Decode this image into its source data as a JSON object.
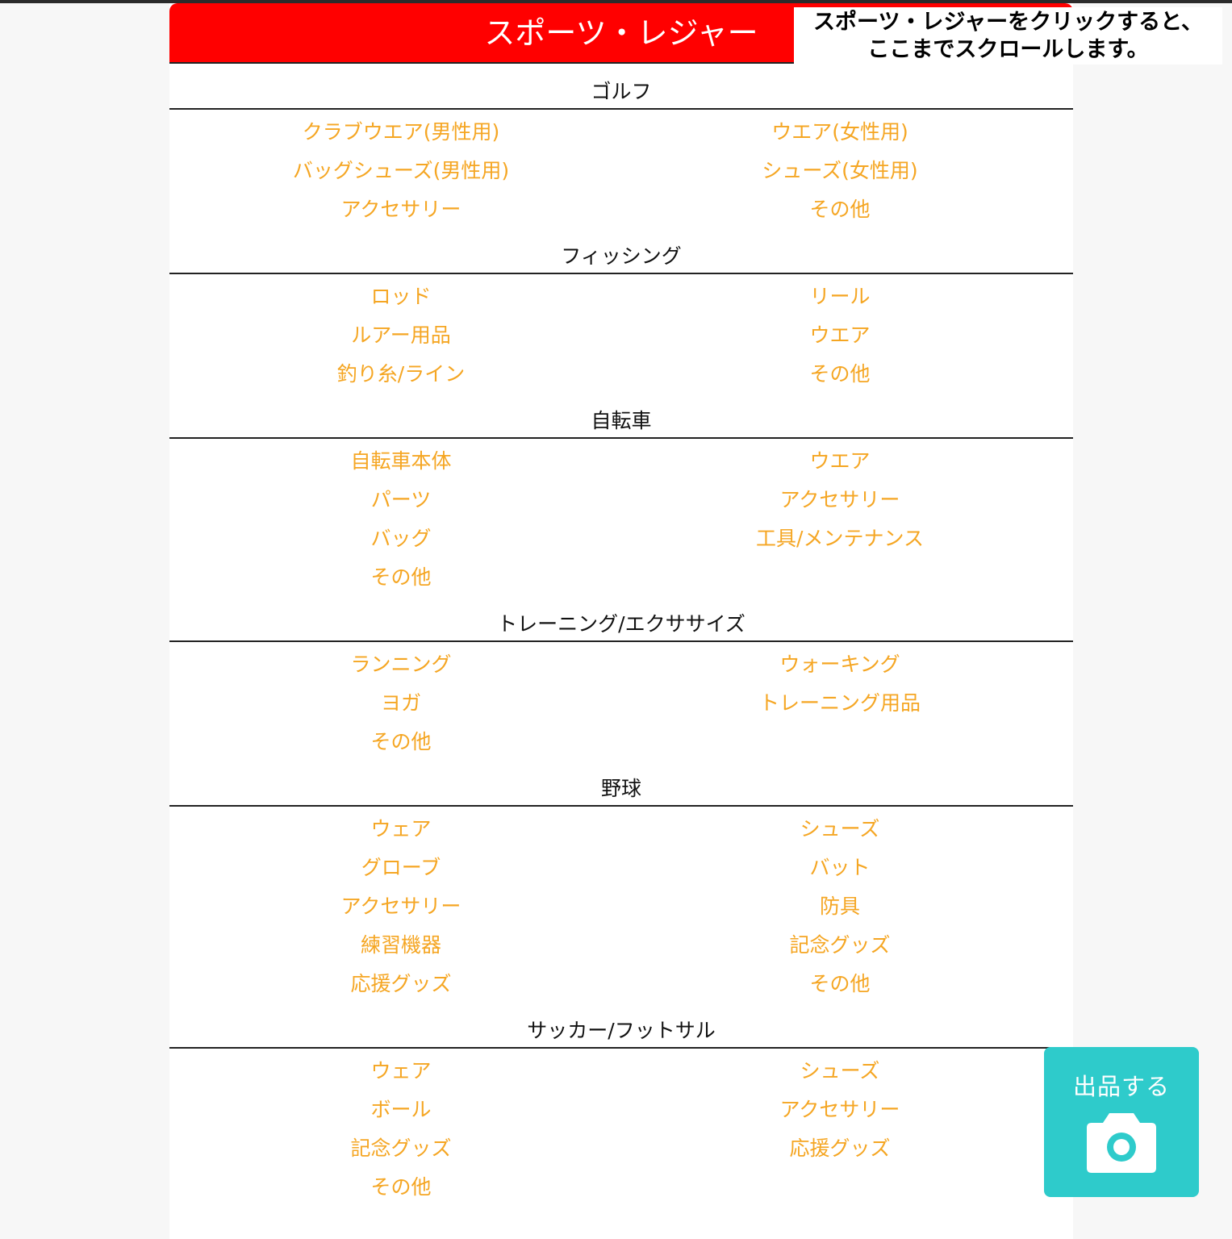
{
  "page": {
    "header_title": "スポーツ・レジャー",
    "note": [
      "スポーツ・レジャーをクリックすると、",
      "ここまでスクロールします。"
    ]
  },
  "sections": [
    {
      "title": "ゴルフ",
      "rows": [
        [
          "クラブウエア(男性用)",
          "ウエア(女性用)"
        ],
        [
          "バッグシューズ(男性用)",
          "シューズ(女性用)"
        ],
        [
          "アクセサリー",
          "その他"
        ]
      ]
    },
    {
      "title": "フィッシング",
      "rows": [
        [
          "ロッド",
          "リール"
        ],
        [
          "ルアー用品",
          "ウエア"
        ],
        [
          "釣り糸/ライン",
          "その他"
        ]
      ]
    },
    {
      "title": "自転車",
      "rows": [
        [
          "自転車本体",
          "ウエア"
        ],
        [
          "パーツ",
          "アクセサリー"
        ],
        [
          "バッグ",
          "工具/メンテナンス"
        ],
        [
          "その他",
          ""
        ]
      ]
    },
    {
      "title": "トレーニング/エクササイズ",
      "rows": [
        [
          "ランニング",
          "ウォーキング"
        ],
        [
          "ヨガ",
          "トレーニング用品"
        ],
        [
          "その他",
          ""
        ]
      ]
    },
    {
      "title": "野球",
      "rows": [
        [
          "ウェア",
          "シューズ"
        ],
        [
          "グローブ",
          "バット"
        ],
        [
          "アクセサリー",
          "防具"
        ],
        [
          "練習機器",
          "記念グッズ"
        ],
        [
          "応援グッズ",
          "その他"
        ]
      ]
    },
    {
      "title": "サッカー/フットサル",
      "rows": [
        [
          "ウェア",
          "シューズ"
        ],
        [
          "ボール",
          "アクセサリー"
        ],
        [
          "記念グッズ",
          "応援グッズ"
        ],
        [
          "その他",
          ""
        ]
      ]
    }
  ],
  "fab": {
    "label": "出品する",
    "icon": "camera-icon"
  },
  "colors": {
    "header": "#ff0000",
    "link": "#f5a623",
    "fab": "#2ecbcb"
  }
}
